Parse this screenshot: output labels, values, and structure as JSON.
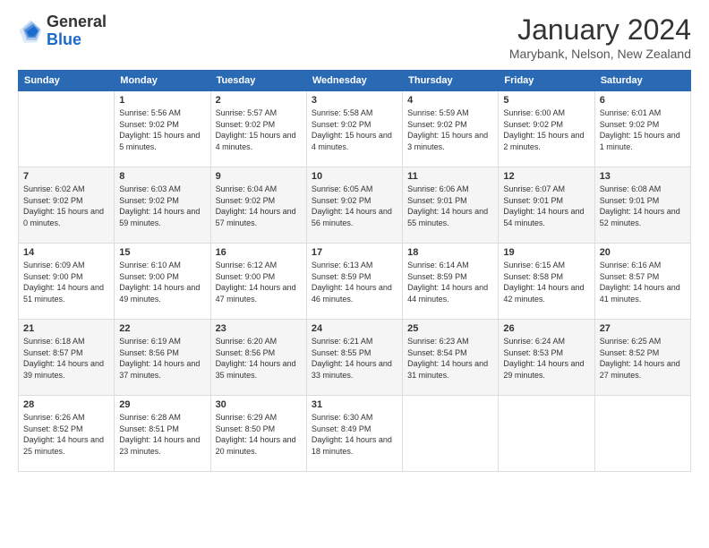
{
  "logo": {
    "general": "General",
    "blue": "Blue"
  },
  "header": {
    "month": "January 2024",
    "location": "Marybank, Nelson, New Zealand"
  },
  "weekdays": [
    "Sunday",
    "Monday",
    "Tuesday",
    "Wednesday",
    "Thursday",
    "Friday",
    "Saturday"
  ],
  "weeks": [
    [
      {
        "day": "",
        "sunrise": "",
        "sunset": "",
        "daylight": ""
      },
      {
        "day": "1",
        "sunrise": "Sunrise: 5:56 AM",
        "sunset": "Sunset: 9:02 PM",
        "daylight": "Daylight: 15 hours and 5 minutes."
      },
      {
        "day": "2",
        "sunrise": "Sunrise: 5:57 AM",
        "sunset": "Sunset: 9:02 PM",
        "daylight": "Daylight: 15 hours and 4 minutes."
      },
      {
        "day": "3",
        "sunrise": "Sunrise: 5:58 AM",
        "sunset": "Sunset: 9:02 PM",
        "daylight": "Daylight: 15 hours and 4 minutes."
      },
      {
        "day": "4",
        "sunrise": "Sunrise: 5:59 AM",
        "sunset": "Sunset: 9:02 PM",
        "daylight": "Daylight: 15 hours and 3 minutes."
      },
      {
        "day": "5",
        "sunrise": "Sunrise: 6:00 AM",
        "sunset": "Sunset: 9:02 PM",
        "daylight": "Daylight: 15 hours and 2 minutes."
      },
      {
        "day": "6",
        "sunrise": "Sunrise: 6:01 AM",
        "sunset": "Sunset: 9:02 PM",
        "daylight": "Daylight: 15 hours and 1 minute."
      }
    ],
    [
      {
        "day": "7",
        "sunrise": "Sunrise: 6:02 AM",
        "sunset": "Sunset: 9:02 PM",
        "daylight": "Daylight: 15 hours and 0 minutes."
      },
      {
        "day": "8",
        "sunrise": "Sunrise: 6:03 AM",
        "sunset": "Sunset: 9:02 PM",
        "daylight": "Daylight: 14 hours and 59 minutes."
      },
      {
        "day": "9",
        "sunrise": "Sunrise: 6:04 AM",
        "sunset": "Sunset: 9:02 PM",
        "daylight": "Daylight: 14 hours and 57 minutes."
      },
      {
        "day": "10",
        "sunrise": "Sunrise: 6:05 AM",
        "sunset": "Sunset: 9:02 PM",
        "daylight": "Daylight: 14 hours and 56 minutes."
      },
      {
        "day": "11",
        "sunrise": "Sunrise: 6:06 AM",
        "sunset": "Sunset: 9:01 PM",
        "daylight": "Daylight: 14 hours and 55 minutes."
      },
      {
        "day": "12",
        "sunrise": "Sunrise: 6:07 AM",
        "sunset": "Sunset: 9:01 PM",
        "daylight": "Daylight: 14 hours and 54 minutes."
      },
      {
        "day": "13",
        "sunrise": "Sunrise: 6:08 AM",
        "sunset": "Sunset: 9:01 PM",
        "daylight": "Daylight: 14 hours and 52 minutes."
      }
    ],
    [
      {
        "day": "14",
        "sunrise": "Sunrise: 6:09 AM",
        "sunset": "Sunset: 9:00 PM",
        "daylight": "Daylight: 14 hours and 51 minutes."
      },
      {
        "day": "15",
        "sunrise": "Sunrise: 6:10 AM",
        "sunset": "Sunset: 9:00 PM",
        "daylight": "Daylight: 14 hours and 49 minutes."
      },
      {
        "day": "16",
        "sunrise": "Sunrise: 6:12 AM",
        "sunset": "Sunset: 9:00 PM",
        "daylight": "Daylight: 14 hours and 47 minutes."
      },
      {
        "day": "17",
        "sunrise": "Sunrise: 6:13 AM",
        "sunset": "Sunset: 8:59 PM",
        "daylight": "Daylight: 14 hours and 46 minutes."
      },
      {
        "day": "18",
        "sunrise": "Sunrise: 6:14 AM",
        "sunset": "Sunset: 8:59 PM",
        "daylight": "Daylight: 14 hours and 44 minutes."
      },
      {
        "day": "19",
        "sunrise": "Sunrise: 6:15 AM",
        "sunset": "Sunset: 8:58 PM",
        "daylight": "Daylight: 14 hours and 42 minutes."
      },
      {
        "day": "20",
        "sunrise": "Sunrise: 6:16 AM",
        "sunset": "Sunset: 8:57 PM",
        "daylight": "Daylight: 14 hours and 41 minutes."
      }
    ],
    [
      {
        "day": "21",
        "sunrise": "Sunrise: 6:18 AM",
        "sunset": "Sunset: 8:57 PM",
        "daylight": "Daylight: 14 hours and 39 minutes."
      },
      {
        "day": "22",
        "sunrise": "Sunrise: 6:19 AM",
        "sunset": "Sunset: 8:56 PM",
        "daylight": "Daylight: 14 hours and 37 minutes."
      },
      {
        "day": "23",
        "sunrise": "Sunrise: 6:20 AM",
        "sunset": "Sunset: 8:56 PM",
        "daylight": "Daylight: 14 hours and 35 minutes."
      },
      {
        "day": "24",
        "sunrise": "Sunrise: 6:21 AM",
        "sunset": "Sunset: 8:55 PM",
        "daylight": "Daylight: 14 hours and 33 minutes."
      },
      {
        "day": "25",
        "sunrise": "Sunrise: 6:23 AM",
        "sunset": "Sunset: 8:54 PM",
        "daylight": "Daylight: 14 hours and 31 minutes."
      },
      {
        "day": "26",
        "sunrise": "Sunrise: 6:24 AM",
        "sunset": "Sunset: 8:53 PM",
        "daylight": "Daylight: 14 hours and 29 minutes."
      },
      {
        "day": "27",
        "sunrise": "Sunrise: 6:25 AM",
        "sunset": "Sunset: 8:52 PM",
        "daylight": "Daylight: 14 hours and 27 minutes."
      }
    ],
    [
      {
        "day": "28",
        "sunrise": "Sunrise: 6:26 AM",
        "sunset": "Sunset: 8:52 PM",
        "daylight": "Daylight: 14 hours and 25 minutes."
      },
      {
        "day": "29",
        "sunrise": "Sunrise: 6:28 AM",
        "sunset": "Sunset: 8:51 PM",
        "daylight": "Daylight: 14 hours and 23 minutes."
      },
      {
        "day": "30",
        "sunrise": "Sunrise: 6:29 AM",
        "sunset": "Sunset: 8:50 PM",
        "daylight": "Daylight: 14 hours and 20 minutes."
      },
      {
        "day": "31",
        "sunrise": "Sunrise: 6:30 AM",
        "sunset": "Sunset: 8:49 PM",
        "daylight": "Daylight: 14 hours and 18 minutes."
      },
      {
        "day": "",
        "sunrise": "",
        "sunset": "",
        "daylight": ""
      },
      {
        "day": "",
        "sunrise": "",
        "sunset": "",
        "daylight": ""
      },
      {
        "day": "",
        "sunrise": "",
        "sunset": "",
        "daylight": ""
      }
    ]
  ]
}
